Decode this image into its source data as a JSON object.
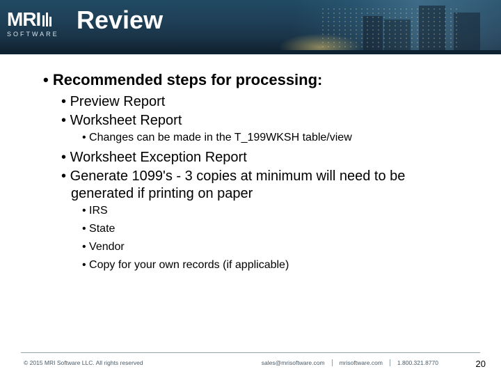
{
  "logo": {
    "brand_top": "MRI",
    "brand_bottom": "SOFTWARE"
  },
  "header": {
    "title": "Review"
  },
  "content": {
    "heading": "Recommended steps for processing:",
    "items_level2_a": [
      "Preview Report",
      "Worksheet Report"
    ],
    "worksheet_note": "Changes can be made in the T_199WKSH table/view",
    "items_level2_b": [
      "Worksheet Exception Report",
      "Generate 1099's - 3 copies at minimum will need to be generated if printing on paper"
    ],
    "copies": [
      "IRS",
      "State",
      "Vendor",
      "Copy for your own records (if applicable)"
    ]
  },
  "footer": {
    "copyright": "© 2015 MRI Software LLC. All rights reserved",
    "email": "sales@mrisoftware.com",
    "site": "mrisoftware.com",
    "phone": "1.800.321.8770",
    "page": "20"
  }
}
